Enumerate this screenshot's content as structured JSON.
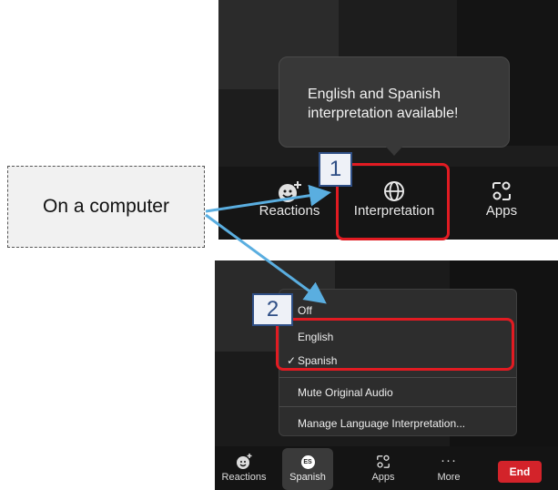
{
  "callout": {
    "text": "On a computer"
  },
  "panel1": {
    "tooltip": {
      "line1": "English and Spanish",
      "line2": "interpretation available!"
    },
    "toolbar": {
      "reactions": {
        "label": "Reactions",
        "icon": "reactions-icon"
      },
      "interpretation": {
        "label": "Interpretation",
        "icon": "globe-icon"
      },
      "apps": {
        "label": "Apps",
        "icon": "apps-icon"
      }
    },
    "badge": "1"
  },
  "panel2": {
    "menu": {
      "items": [
        {
          "label": "Off"
        },
        {
          "label": "English"
        },
        {
          "label": "Spanish",
          "checked": true,
          "check": "✓"
        },
        {
          "label": "Mute Original Audio"
        },
        {
          "label": "Manage Language Interpretation..."
        }
      ]
    },
    "toolbar": {
      "reactions": "Reactions",
      "spanish": "Spanish",
      "es_badge": "ES",
      "apps": "Apps",
      "more": "More",
      "more_glyph": "···",
      "end": "End"
    },
    "badge": "2"
  },
  "colors": {
    "highlight": "#e11b22",
    "arrow": "#5aaee0",
    "badge_border": "#2f4f86",
    "end_button": "#d3232a"
  }
}
